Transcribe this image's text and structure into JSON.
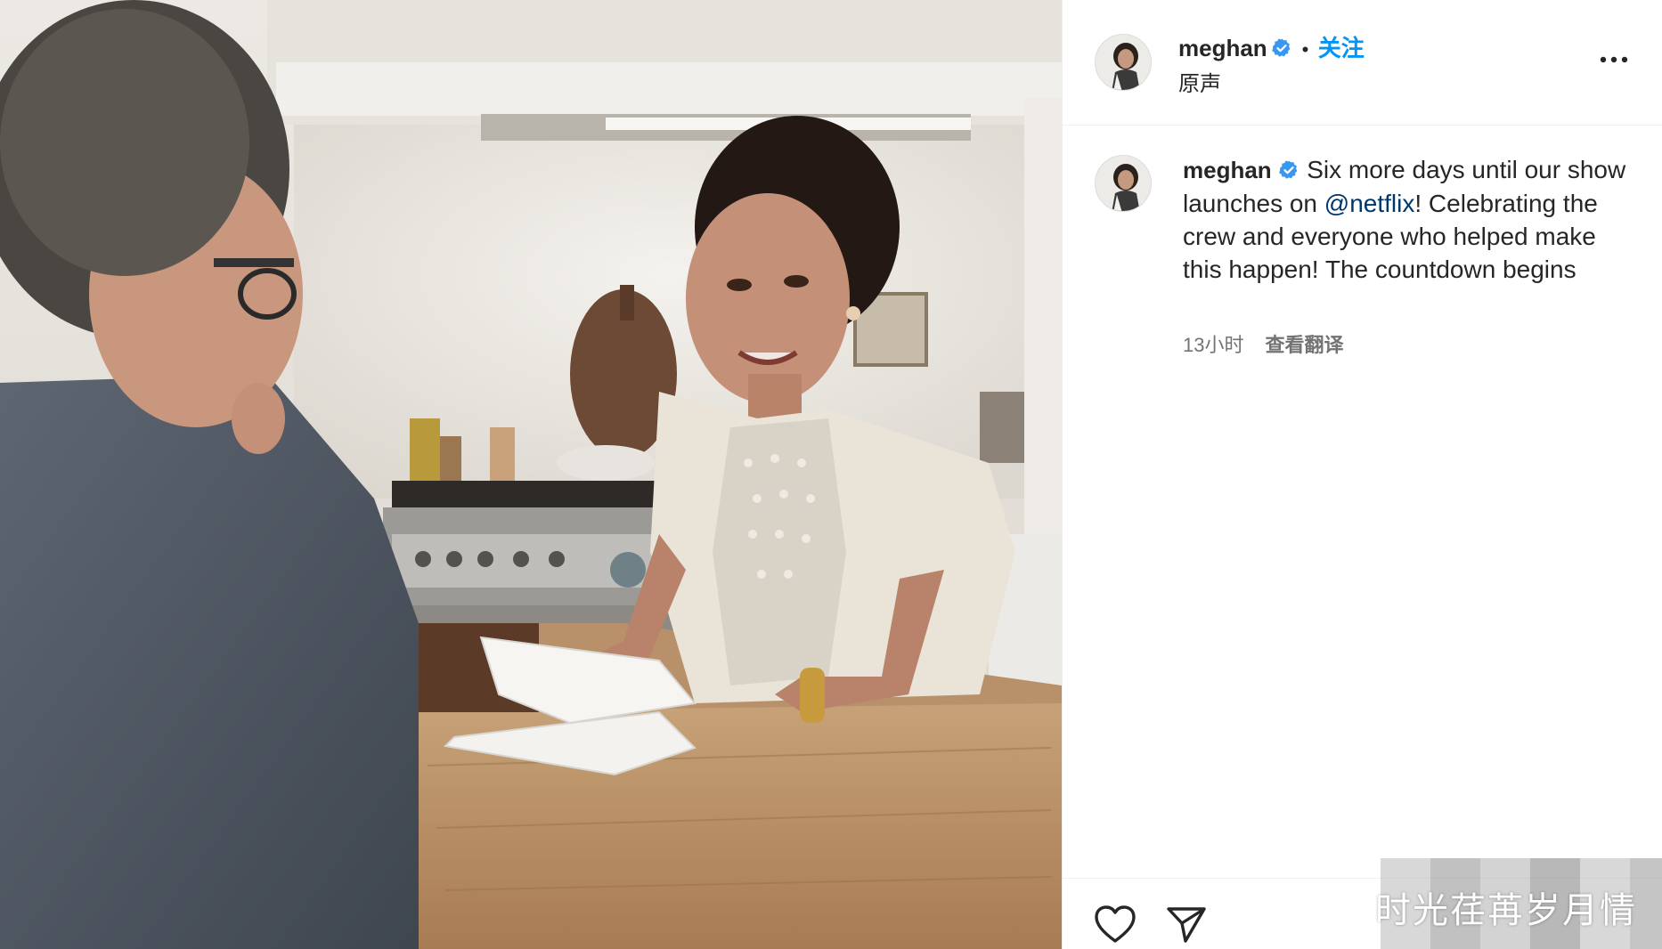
{
  "header": {
    "username": "meghan",
    "separator": "•",
    "follow_label": "关注",
    "audio_label": "原声",
    "more_icon": "more-icon"
  },
  "caption": {
    "username": "meghan",
    "text_before_mention": "Six more days until our show launches on ",
    "mention": "@netflix",
    "text_after_mention": "! Celebrating the crew and everyone who helped make this happen! The countdown begins",
    "time": "13小时",
    "translate_label": "查看翻译"
  },
  "actions": {
    "like_icon": "heart-icon",
    "share_icon": "send-icon"
  },
  "watermark": {
    "text": "时光荏苒岁月情"
  },
  "colors": {
    "accent": "#0095f6",
    "verified": "#3897f0",
    "text": "#262626",
    "secondary": "#737373",
    "mention": "#00376b"
  }
}
